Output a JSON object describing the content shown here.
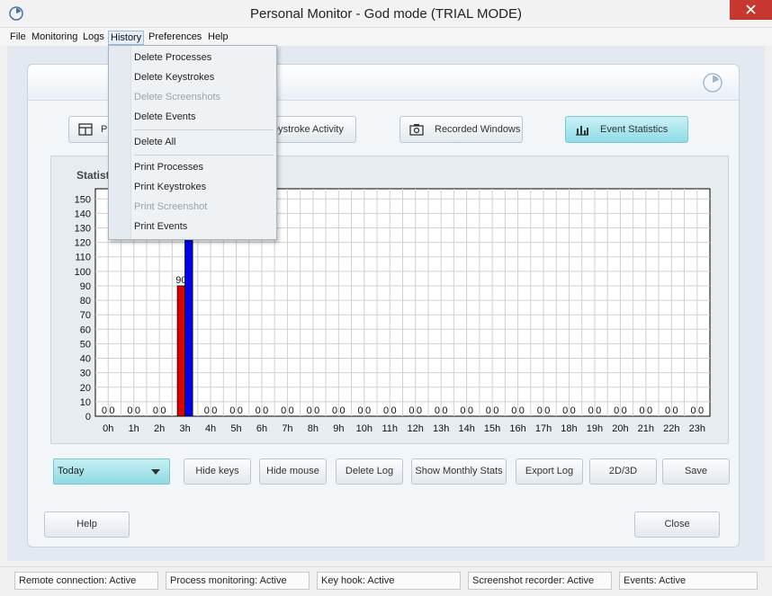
{
  "window": {
    "title": "Personal Monitor - God mode (TRIAL MODE)"
  },
  "menu": {
    "file": "File",
    "monitoring": "Monitoring",
    "logs": "Logs",
    "history": "History",
    "preferences": "Preferences",
    "help": "Help"
  },
  "history_menu": {
    "items": [
      {
        "label": "Delete Processes",
        "enabled": true
      },
      {
        "label": "Delete Keystrokes",
        "enabled": true
      },
      {
        "label": "Delete Screenshots",
        "enabled": false
      },
      {
        "label": "Delete Events",
        "enabled": true
      },
      {
        "label": "Delete All",
        "enabled": true
      },
      {
        "label": "Print Processes",
        "enabled": true
      },
      {
        "label": "Print Keystrokes",
        "enabled": true
      },
      {
        "label": "Print Screenshot",
        "enabled": false
      },
      {
        "label": "Print Events",
        "enabled": true
      }
    ]
  },
  "tabs": {
    "processes": "Pr",
    "keystroke_activity": "eystroke Activity",
    "recorded_windows": "Recorded Windows",
    "event_statistics": "Event Statistics"
  },
  "chart": {
    "title": "Statist"
  },
  "chart_data": {
    "type": "bar",
    "title": "Statist",
    "categories": [
      "0h",
      "1h",
      "2h",
      "3h",
      "4h",
      "5h",
      "6h",
      "7h",
      "8h",
      "9h",
      "10h",
      "11h",
      "12h",
      "13h",
      "14h",
      "15h",
      "16h",
      "17h",
      "18h",
      "19h",
      "20h",
      "21h",
      "22h",
      "23h"
    ],
    "series": [
      {
        "color": "#e00000",
        "values": [
          0,
          0,
          0,
          90,
          0,
          0,
          0,
          0,
          0,
          0,
          0,
          0,
          0,
          0,
          0,
          0,
          0,
          0,
          0,
          0,
          0,
          0,
          0,
          0
        ]
      },
      {
        "color": "#0000e8",
        "values": [
          0,
          0,
          0,
          155,
          0,
          0,
          0,
          0,
          0,
          0,
          0,
          0,
          0,
          0,
          0,
          0,
          0,
          0,
          0,
          0,
          0,
          0,
          0,
          0
        ]
      }
    ],
    "data_labels": [
      "0",
      "0",
      "0",
      "0",
      "0",
      "0",
      "90",
      "",
      "0",
      "0",
      "0",
      "0",
      "0",
      "0",
      "0",
      "0",
      "0",
      "0",
      "0",
      "0",
      "0",
      "0",
      "0",
      "0",
      "0",
      "0",
      "0",
      "0",
      "0",
      "0",
      "0",
      "0",
      "0",
      "0",
      "0",
      "0",
      "0",
      "0",
      "0",
      "0",
      "0",
      "0",
      "0",
      "0",
      "0",
      "0",
      "0",
      "0"
    ],
    "yticks": [
      0,
      10,
      20,
      30,
      40,
      50,
      60,
      70,
      80,
      90,
      100,
      110,
      120,
      130,
      140,
      150
    ],
    "ylim": [
      0,
      157
    ],
    "grid": true
  },
  "controls": {
    "period": "Today",
    "hide_keys": "Hide keys",
    "hide_mouse": "Hide mouse",
    "delete_log": "Delete Log",
    "show_monthly_stats": "Show Monthly Stats",
    "export_log": "Export Log",
    "view_mode": "2D/3D",
    "save": "Save"
  },
  "footer": {
    "help": "Help",
    "close": "Close"
  },
  "status": {
    "remote": "Remote connection: Active",
    "process": "Process monitoring: Active",
    "keyhook": "Key hook: Active",
    "screenshot": "Screenshot recorder: Active",
    "events": "Events: Active"
  },
  "colors": {
    "accent": "#8fdae3",
    "close": "#c7372f"
  }
}
